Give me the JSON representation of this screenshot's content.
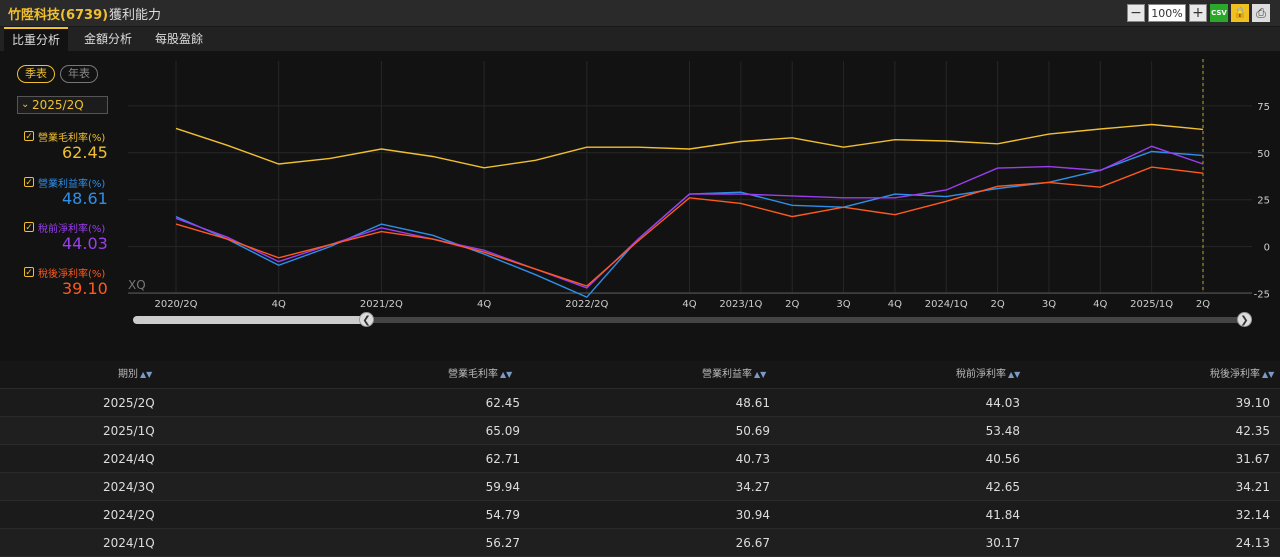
{
  "header": {
    "title": "竹陞科技(6739)",
    "subtitle": "獲利能力",
    "zoom": "100%",
    "csv_label": "CSV"
  },
  "tabs": [
    {
      "label": "比重分析",
      "active": true
    },
    {
      "label": "金額分析",
      "active": false
    },
    {
      "label": "每股盈餘",
      "active": false
    }
  ],
  "controls": {
    "season_label": "季表",
    "year_label": "年表",
    "period": "2025/2Q"
  },
  "legend": [
    {
      "name": "營業毛利率(%)",
      "value": "62.45",
      "color": "#f0c030"
    },
    {
      "name": "營業利益率(%)",
      "value": "48.61",
      "color": "#2f8fe8"
    },
    {
      "name": "稅前淨利率(%)",
      "value": "44.03",
      "color": "#9b3ef0"
    },
    {
      "name": "稅後淨利率(%)",
      "value": "39.10",
      "color": "#ff5a1e"
    }
  ],
  "watermark": "XQ",
  "chart_data": {
    "type": "line",
    "x": [
      "2020/2Q",
      "3Q",
      "4Q",
      "2021/1Q",
      "2021/2Q",
      "3Q",
      "4Q",
      "2022/1Q",
      "2022/2Q",
      "3Q",
      "4Q",
      "2023/1Q",
      "2Q",
      "3Q",
      "4Q",
      "2024/1Q",
      "2Q",
      "3Q",
      "4Q",
      "2025/1Q",
      "2Q"
    ],
    "x_tick_labels": [
      "2020/2Q",
      "4Q",
      "2021/2Q",
      "4Q",
      "2022/2Q",
      "4Q",
      "2023/1Q",
      "2Q",
      "3Q",
      "4Q",
      "2024/1Q",
      "2Q",
      "3Q",
      "4Q",
      "2025/1Q",
      "2Q"
    ],
    "y_ticks": [
      75,
      50,
      25,
      0,
      -25
    ],
    "ylim": [
      -45,
      100
    ],
    "grid": true,
    "series": [
      {
        "name": "營業毛利率(%)",
        "color": "#f0c030",
        "values": [
          63,
          54,
          44,
          47,
          52,
          48,
          42,
          46,
          53,
          53,
          52,
          56,
          58,
          53,
          57,
          56.27,
          54.79,
          59.94,
          62.71,
          65.09,
          62.45
        ]
      },
      {
        "name": "營業利益率(%)",
        "color": "#2f8fe8",
        "values": [
          16,
          4,
          -10,
          0,
          12,
          6,
          -4,
          -15,
          -27,
          4,
          28,
          29,
          22,
          21,
          28,
          26.67,
          30.94,
          34.27,
          40.73,
          50.69,
          48.61
        ]
      },
      {
        "name": "稅前淨利率(%)",
        "color": "#9b3ef0",
        "values": [
          15,
          5,
          -8,
          1,
          10,
          4,
          -2,
          -12,
          -22,
          4,
          28,
          28,
          27,
          26,
          26,
          30.17,
          41.84,
          42.65,
          40.56,
          53.48,
          44.03
        ]
      },
      {
        "name": "稅後淨利率(%)",
        "color": "#ff5a1e",
        "values": [
          12,
          4,
          -6,
          1,
          8,
          4,
          -3,
          -12,
          -21,
          3,
          26,
          23,
          16,
          21,
          17,
          24.13,
          32.14,
          34.21,
          31.67,
          42.35,
          39.1
        ]
      }
    ]
  },
  "table": {
    "headers": [
      "期別",
      "營業毛利率",
      "營業利益率",
      "稅前淨利率",
      "稅後淨利率"
    ],
    "rows": [
      [
        "2025/2Q",
        "62.45",
        "48.61",
        "44.03",
        "39.10"
      ],
      [
        "2025/1Q",
        "65.09",
        "50.69",
        "53.48",
        "42.35"
      ],
      [
        "2024/4Q",
        "62.71",
        "40.73",
        "40.56",
        "31.67"
      ],
      [
        "2024/3Q",
        "59.94",
        "34.27",
        "42.65",
        "34.21"
      ],
      [
        "2024/2Q",
        "54.79",
        "30.94",
        "41.84",
        "32.14"
      ],
      [
        "2024/1Q",
        "56.27",
        "26.67",
        "30.17",
        "24.13"
      ]
    ]
  }
}
